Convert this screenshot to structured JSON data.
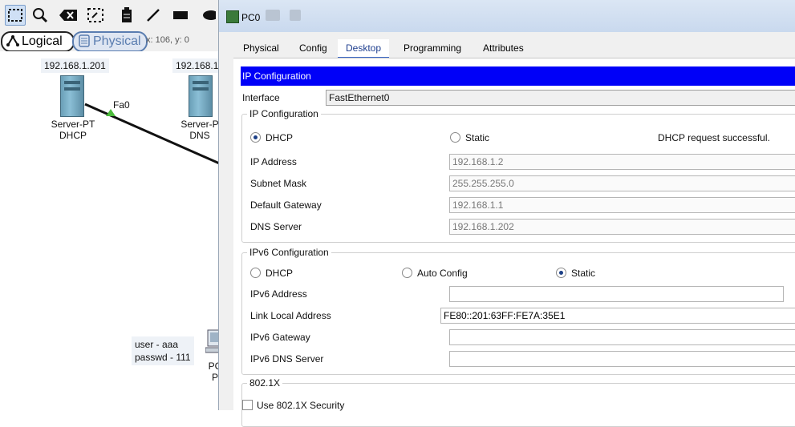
{
  "workspace": {
    "view_tabs": {
      "logical": "Logical",
      "physical": "Physical"
    },
    "coords": "x: 106, y: 0",
    "devices": [
      {
        "ip": "192.168.1.201",
        "name_line1": "Server-PT",
        "name_line2": "DHCP",
        "port": "Fa0"
      },
      {
        "ip": "192.168.1.",
        "name_line1": "Server-P",
        "name_line2": "DNS"
      },
      {
        "name_line1": "PC",
        "name_line2": "P"
      }
    ],
    "note": {
      "line1": "user - aaa",
      "line2": "passwd - 111"
    }
  },
  "window": {
    "title": "PC0",
    "tabs": [
      "Physical",
      "Config",
      "Desktop",
      "Programming",
      "Attributes"
    ],
    "active_tab": "Desktop",
    "header": "IP Configuration",
    "interface_label": "Interface",
    "interface_value": "FastEthernet0",
    "ipv4": {
      "legend": "IP Configuration",
      "dhcp_label": "DHCP",
      "static_label": "Static",
      "selected": "DHCP",
      "status": "DHCP request successful.",
      "fields": [
        {
          "label": "IP Address",
          "value": "192.168.1.2"
        },
        {
          "label": "Subnet Mask",
          "value": "255.255.255.0"
        },
        {
          "label": "Default Gateway",
          "value": "192.168.1.1"
        },
        {
          "label": "DNS Server",
          "value": "192.168.1.202"
        }
      ]
    },
    "ipv6": {
      "legend": "IPv6 Configuration",
      "dhcp_label": "DHCP",
      "auto_label": "Auto Config",
      "static_label": "Static",
      "selected": "Static",
      "fields": [
        {
          "label": "IPv6 Address",
          "value": ""
        },
        {
          "label": "Link Local Address",
          "value": "FE80::201:63FF:FE7A:35E1"
        },
        {
          "label": "IPv6 Gateway",
          "value": ""
        },
        {
          "label": "IPv6 DNS Server",
          "value": ""
        }
      ]
    },
    "dot1x": {
      "legend": "802.1X",
      "checkbox_label": "Use 802.1X Security"
    }
  },
  "colors": {
    "header_bg": "#0000f8",
    "active_tab": "#1f3f8f"
  }
}
